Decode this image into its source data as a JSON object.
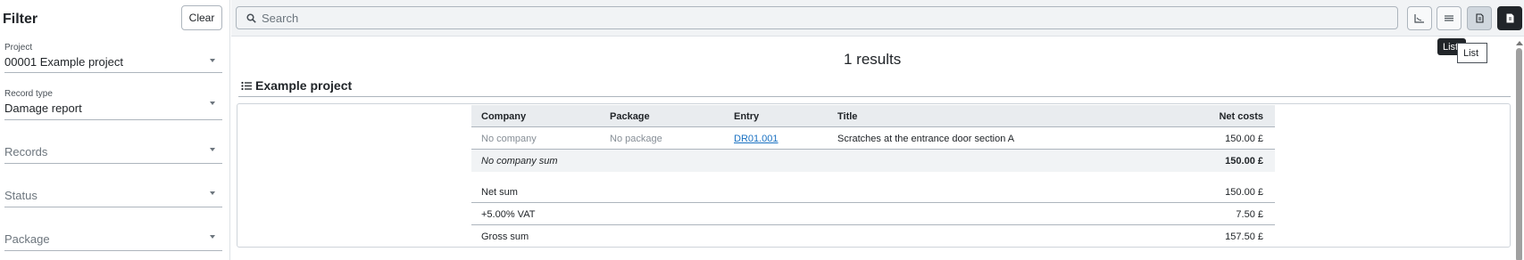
{
  "sidebar": {
    "title": "Filter",
    "clear_label": "Clear",
    "project": {
      "label": "Project",
      "value": "00001 Example project"
    },
    "record_type": {
      "label": "Record type",
      "value": "Damage report"
    },
    "records_placeholder": "Records",
    "status_placeholder": "Status",
    "package_placeholder": "Package"
  },
  "topbar": {
    "search_placeholder": "Search",
    "view_buttons": [
      "chart-icon",
      "list-lines-icon",
      "document-icon",
      "document-export-icon"
    ]
  },
  "tooltip": {
    "dark_text": "List",
    "light_text": "List"
  },
  "main": {
    "results_text": "1 results",
    "section_title": "Example project",
    "table": {
      "columns": [
        "Company",
        "Package",
        "Entry",
        "Title",
        "Net costs"
      ],
      "rows": [
        {
          "company": "No company",
          "package": "No package",
          "entry": "DR01.001",
          "title": "Scratches at the entrance door section A",
          "net_costs": "150.00 £"
        }
      ],
      "subtotal": {
        "label": "No company sum",
        "value": "150.00 £"
      },
      "totals": [
        {
          "label": "Net sum",
          "value": "150.00 £"
        },
        {
          "label": "+5.00% VAT",
          "value": "7.50 £"
        },
        {
          "label": "Gross sum",
          "value": "157.50 £"
        }
      ]
    }
  },
  "colors": {
    "accent_link": "#1971c2",
    "dark_button": "#212529",
    "topbar_bg": "#f1f3f5"
  }
}
